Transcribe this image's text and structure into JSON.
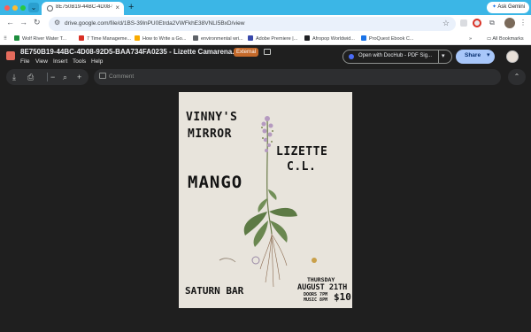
{
  "browser": {
    "tab_title": "8E750B19-44BC-4D08-92D5...",
    "new_tab": "+",
    "ask_gemini": "Ask Gemini",
    "url": "drive.google.com/file/d/1BS-39lnPU0Etrda2VWFkhE38VNLI5BxD/view",
    "bookmarks": [
      {
        "label": "Wolf River Water T...",
        "color": "#1e8e3e"
      },
      {
        "label": "7 Time Manageme...",
        "color": "#d93025"
      },
      {
        "label": "How to Write a Go...",
        "color": "#f9ab00"
      },
      {
        "label": "environmental wri...",
        "color": "#5f6368"
      },
      {
        "label": "Adobe Premiere |...",
        "color": "#3949ab"
      },
      {
        "label": "Afropop Worldwid...",
        "color": "#202124"
      },
      {
        "label": "ProQuest Ebook C...",
        "color": "#1a73e8"
      }
    ],
    "all_bookmarks": "All Bookmarks"
  },
  "drive": {
    "file_title": "8E750B19-44BC-4D08-92D5-BAA734FA0235 - Lizette Camarena.JPG",
    "external_badge": "External",
    "menu": [
      "File",
      "View",
      "Insert",
      "Tools",
      "Help"
    ],
    "open_with": "Open with DocHub - PDF Sig...",
    "share": "Share",
    "comment_placeholder": "Comment"
  },
  "poster": {
    "band_line1": "VINNY'S",
    "band_line2": "MIRROR",
    "band_line3": "LIZETTE",
    "band_line4": "C.L.",
    "band_line5": "MANGO",
    "venue": "SATURN BAR",
    "day": "THURSDAY",
    "date": "AUGUST 21TH",
    "doors": "DOORS 7PM",
    "music": "MUSIC 8PM",
    "price": "$10"
  },
  "icons": {
    "back": "←",
    "forward": "→",
    "reload": "↻",
    "star": "☆",
    "puzzle": "⧉",
    "download": "⤓",
    "print": "⎙",
    "zoom_out": "−",
    "zoom_in": "+",
    "chevron_up": "⌃",
    "dropdown": "▾"
  }
}
